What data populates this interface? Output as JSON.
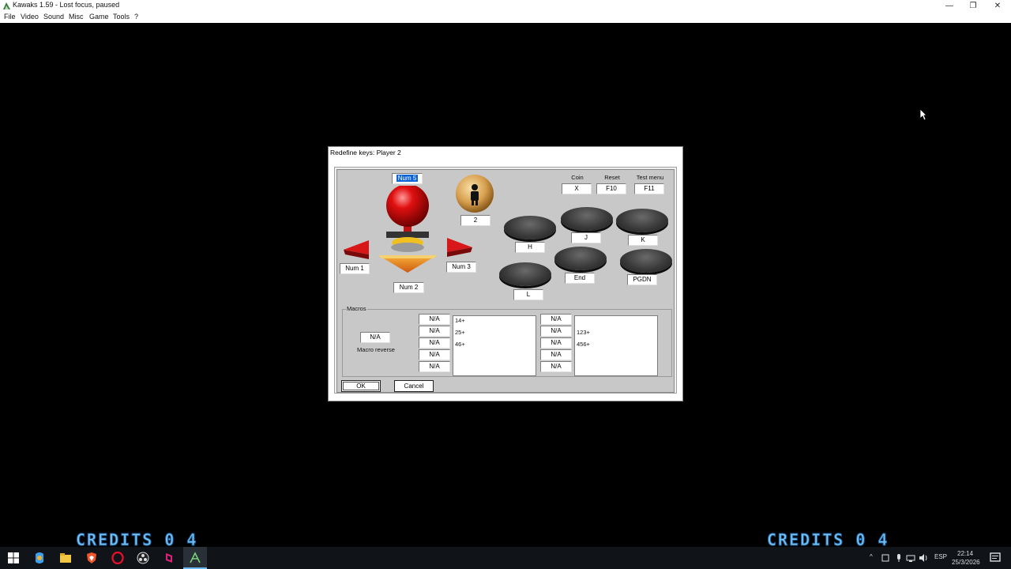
{
  "window": {
    "title": "Kawaks 1.59 - Lost focus, paused",
    "minimize_glyph": "—",
    "maximize_glyph": "❐",
    "close_glyph": "✕"
  },
  "menu": [
    "File",
    "Video",
    "Sound",
    "Misc",
    "Game",
    "Tools",
    "?"
  ],
  "game": {
    "credits_left": "CREDITS  0 4",
    "credits_right": "CREDITS  0 4"
  },
  "dialog": {
    "title": "Redefine keys: Player 2",
    "keys": {
      "up": "Num 5",
      "down": "Num 2",
      "left": "Num 1",
      "right": "Num 3",
      "start": "2",
      "coin_label": "Coin",
      "coin": "X",
      "reset_label": "Reset",
      "reset": "F10",
      "test_menu_label": "Test menu",
      "test_menu": "F11",
      "button_h": "H",
      "button_j": "J",
      "button_k": "K",
      "button_end": "End",
      "button_pgdn": "PGDN",
      "button_l": "L"
    },
    "macros": {
      "group_label": "Macros",
      "reverse_value": "N/A",
      "reverse_label": "Macro reverse",
      "left_keys": [
        "N/A",
        "N/A",
        "N/A",
        "N/A",
        "N/A"
      ],
      "left_list": [
        "14+",
        "25+",
        "46+"
      ],
      "right_keys": [
        "N/A",
        "N/A",
        "N/A",
        "N/A",
        "N/A"
      ],
      "right_list": [
        "123+",
        "456+"
      ]
    },
    "ok_label": "OK",
    "cancel_label": "Cancel"
  },
  "taskbar": {
    "language": "ESP",
    "time": "22:14",
    "date": "25/3/2026"
  },
  "colors": {
    "joystick_ball": "#e01010",
    "arrow_red": "#d81818",
    "arrow_orange": "#f08a1e",
    "credits": "#7cc4f0",
    "selection": "#0a64d8"
  }
}
